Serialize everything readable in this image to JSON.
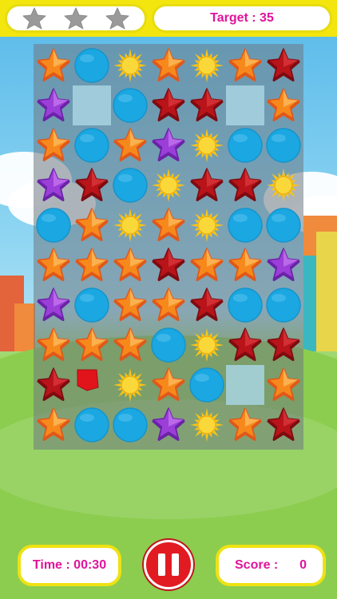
{
  "hud": {
    "stars_earned": 0,
    "stars_total": 3,
    "target_label": "Target : 35",
    "time_label": "Time : 00:30",
    "score_label": "Score :",
    "score_value": "0"
  },
  "colors": {
    "top_bar": "#f2e60e",
    "label_text": "#e0149b",
    "pause_button": "#e21b22"
  },
  "board": {
    "rows": 10,
    "cols": 7,
    "pieces": [
      [
        "orange-star",
        "blue-circle",
        "sun",
        "orange-star",
        "sun",
        "orange-star",
        "red-star"
      ],
      [
        "purple-star",
        "empty",
        "blue-circle",
        "red-star",
        "red-star",
        "empty",
        "orange-star"
      ],
      [
        "orange-star",
        "blue-circle",
        "orange-star",
        "purple-star",
        "sun",
        "blue-circle",
        "blue-circle"
      ],
      [
        "purple-star",
        "red-star",
        "blue-circle",
        "sun",
        "red-star",
        "red-star",
        "sun"
      ],
      [
        "blue-circle",
        "orange-star",
        "sun",
        "orange-star",
        "sun",
        "blue-circle",
        "blue-circle"
      ],
      [
        "orange-star",
        "orange-star",
        "orange-star",
        "red-star",
        "orange-star",
        "orange-star",
        "purple-star"
      ],
      [
        "purple-star",
        "blue-circle",
        "orange-star",
        "orange-star",
        "red-star",
        "blue-circle",
        "blue-circle"
      ],
      [
        "orange-star",
        "orange-star",
        "orange-star",
        "blue-circle",
        "sun",
        "red-star",
        "red-star"
      ],
      [
        "red-star",
        "red-flag",
        "sun",
        "orange-star",
        "blue-circle",
        "empty",
        "orange-star"
      ],
      [
        "orange-star",
        "blue-circle",
        "blue-circle",
        "purple-star",
        "sun",
        "orange-star",
        "red-star"
      ]
    ]
  }
}
